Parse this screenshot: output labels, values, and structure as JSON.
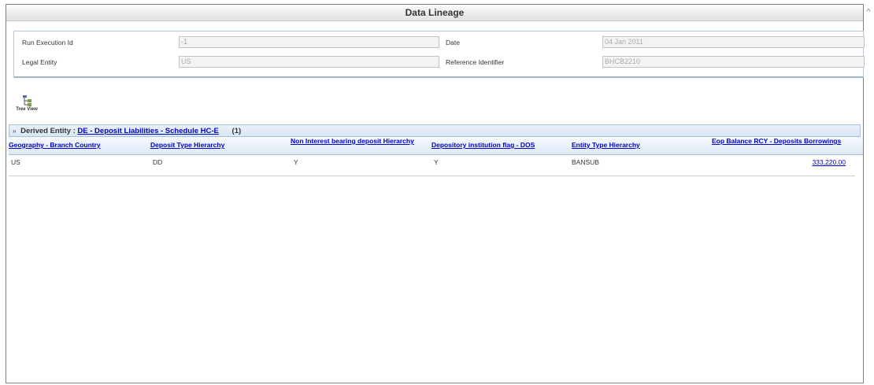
{
  "window": {
    "title": "Data Lineage"
  },
  "params": {
    "run_execution_id_label": "Run Execution Id",
    "run_execution_id_value": "-1",
    "date_label": "Date",
    "date_value": "04 Jan 2011",
    "legal_entity_label": "Legal Entity",
    "legal_entity_value": "US",
    "reference_identifier_label": "Reference Identifier",
    "reference_identifier_value": "BHCB2210"
  },
  "toolbar": {
    "tree_view_label": "Tree View"
  },
  "grid": {
    "prefix": "Derived Entity :",
    "entity_link": "DE - Deposit Liabilities - Schedule HC-E",
    "count": "(1)",
    "columns": [
      "Geography - Branch Country",
      "Deposit Type Hierarchy",
      "Non Interest bearing deposit Hierarchy",
      "Depository institution flag - DOS",
      "Entity Type Hierarchy",
      "Eop Balance RCY - Deposits Borrowings"
    ],
    "rows": [
      [
        "US",
        "DD",
        "Y",
        "Y",
        "BANSUB",
        "333,220.00"
      ]
    ]
  }
}
